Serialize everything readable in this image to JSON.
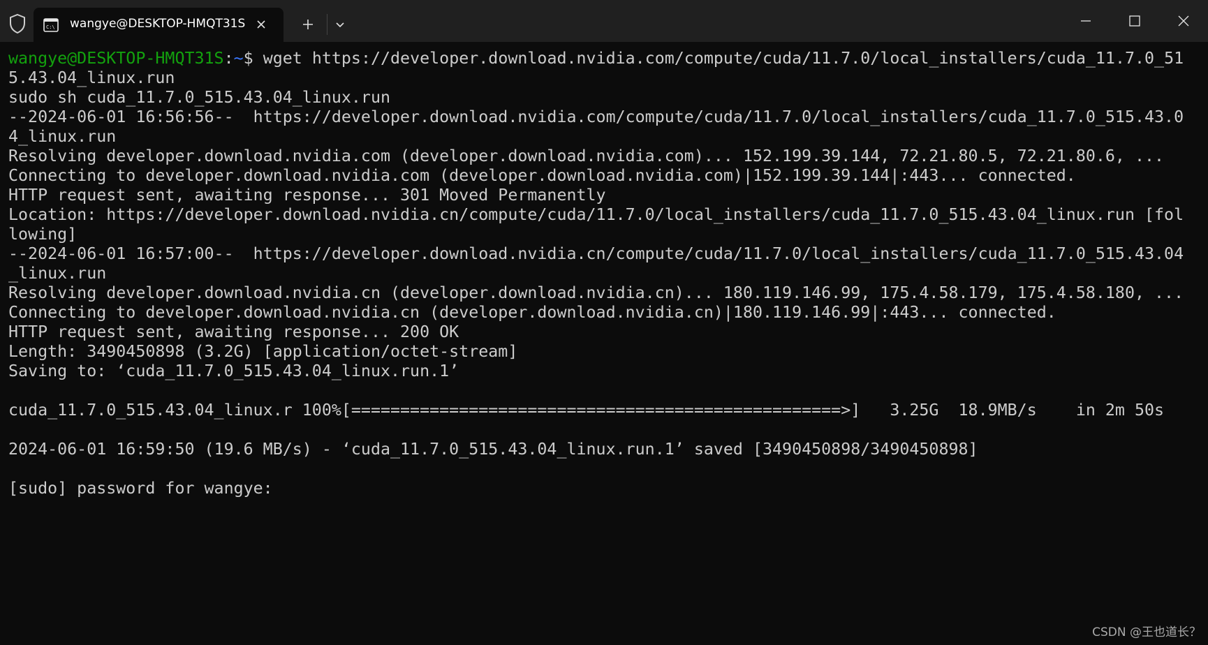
{
  "window": {
    "tab_title": "wangye@DESKTOP-HMQT31S",
    "tab_icon": "terminal-icon",
    "shield_icon": "shield-icon",
    "new_tab_icon": "plus-icon",
    "dropdown_icon": "chevron-down-icon",
    "minimize_icon": "minimize-icon",
    "maximize_icon": "maximize-icon",
    "close_icon": "close-icon"
  },
  "prompt": {
    "user_host": "wangye@DESKTOP-HMQT31S",
    "colon": ":",
    "path": "~",
    "symbol": "$",
    "command": " wget https://developer.download.nvidia.com/compute/cuda/11.7.0/local_installers/cuda_11.7.0_51"
  },
  "colors": {
    "prompt_user": "#13a10e",
    "prompt_path": "#3b78ff",
    "text": "#cccccc",
    "background": "#0c0c0c"
  },
  "lines": [
    "5.43.04_linux.run",
    "sudo sh cuda_11.7.0_515.43.04_linux.run",
    "--2024-06-01 16:56:56--  https://developer.download.nvidia.com/compute/cuda/11.7.0/local_installers/cuda_11.7.0_515.43.0",
    "4_linux.run",
    "Resolving developer.download.nvidia.com (developer.download.nvidia.com)... 152.199.39.144, 72.21.80.5, 72.21.80.6, ...",
    "Connecting to developer.download.nvidia.com (developer.download.nvidia.com)|152.199.39.144|:443... connected.",
    "HTTP request sent, awaiting response... 301 Moved Permanently",
    "Location: https://developer.download.nvidia.cn/compute/cuda/11.7.0/local_installers/cuda_11.7.0_515.43.04_linux.run [fol",
    "lowing]",
    "--2024-06-01 16:57:00--  https://developer.download.nvidia.cn/compute/cuda/11.7.0/local_installers/cuda_11.7.0_515.43.04",
    "_linux.run",
    "Resolving developer.download.nvidia.cn (developer.download.nvidia.cn)... 180.119.146.99, 175.4.58.179, 175.4.58.180, ...",
    "Connecting to developer.download.nvidia.cn (developer.download.nvidia.cn)|180.119.146.99|:443... connected.",
    "HTTP request sent, awaiting response... 200 OK",
    "Length: 3490450898 (3.2G) [application/octet-stream]",
    "Saving to: ‘cuda_11.7.0_515.43.04_linux.run.1’",
    "",
    "cuda_11.7.0_515.43.04_linux.r 100%[==================================================>]   3.25G  18.9MB/s    in 2m 50s",
    "",
    "2024-06-01 16:59:50 (19.6 MB/s) - ‘cuda_11.7.0_515.43.04_linux.run.1’ saved [3490450898/3490450898]",
    "",
    "[sudo] password for wangye:"
  ],
  "watermark": "CSDN @王也道长？"
}
